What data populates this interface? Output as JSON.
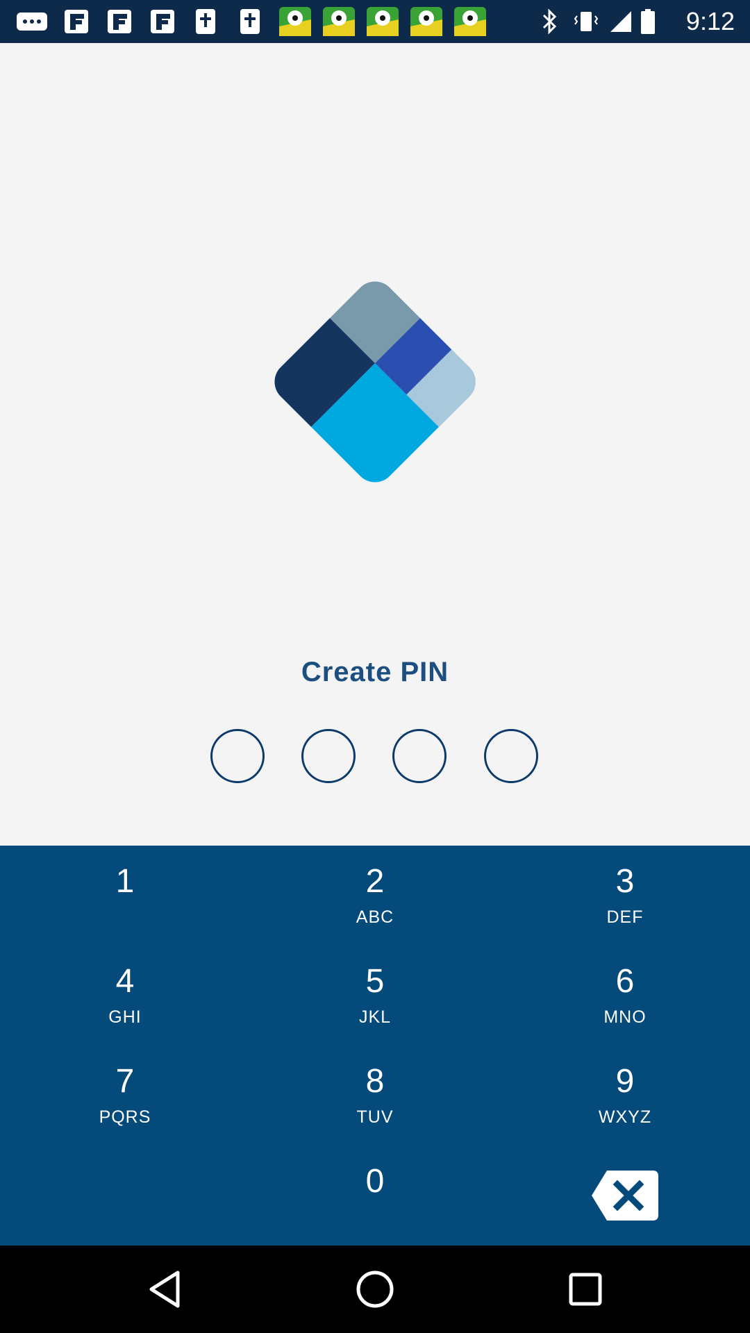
{
  "status_bar": {
    "time": "9:12",
    "icons": [
      "more-notifications-icon",
      "flipboard-icon",
      "flipboard-icon",
      "flipboard-icon",
      "bible-icon",
      "bible-icon",
      "soccer-game-icon",
      "soccer-game-icon",
      "soccer-game-icon",
      "soccer-game-icon",
      "soccer-game-icon",
      "bluetooth-icon",
      "vibrate-icon",
      "signal-icon",
      "battery-icon"
    ]
  },
  "screen": {
    "title": "Create PIN",
    "pin_length": 4,
    "colors": {
      "title": "#1c4f80",
      "keypad_bg": "#044a7a",
      "logo_top": "#7a9aab",
      "logo_left": "#14365e",
      "logo_right": "#2a4fb0",
      "logo_small": "#a8c8dc",
      "logo_bottom": "#00a8e0"
    }
  },
  "keypad": {
    "keys": [
      {
        "number": "1",
        "letters": ""
      },
      {
        "number": "2",
        "letters": "ABC"
      },
      {
        "number": "3",
        "letters": "DEF"
      },
      {
        "number": "4",
        "letters": "GHI"
      },
      {
        "number": "5",
        "letters": "JKL"
      },
      {
        "number": "6",
        "letters": "MNO"
      },
      {
        "number": "7",
        "letters": "PQRS"
      },
      {
        "number": "8",
        "letters": "TUV"
      },
      {
        "number": "9",
        "letters": "WXYZ"
      },
      {
        "number": "0",
        "letters": ""
      }
    ],
    "backspace_icon": "backspace-icon"
  },
  "nav_bar": {
    "icons": [
      "back-icon",
      "home-icon",
      "recents-icon"
    ]
  }
}
